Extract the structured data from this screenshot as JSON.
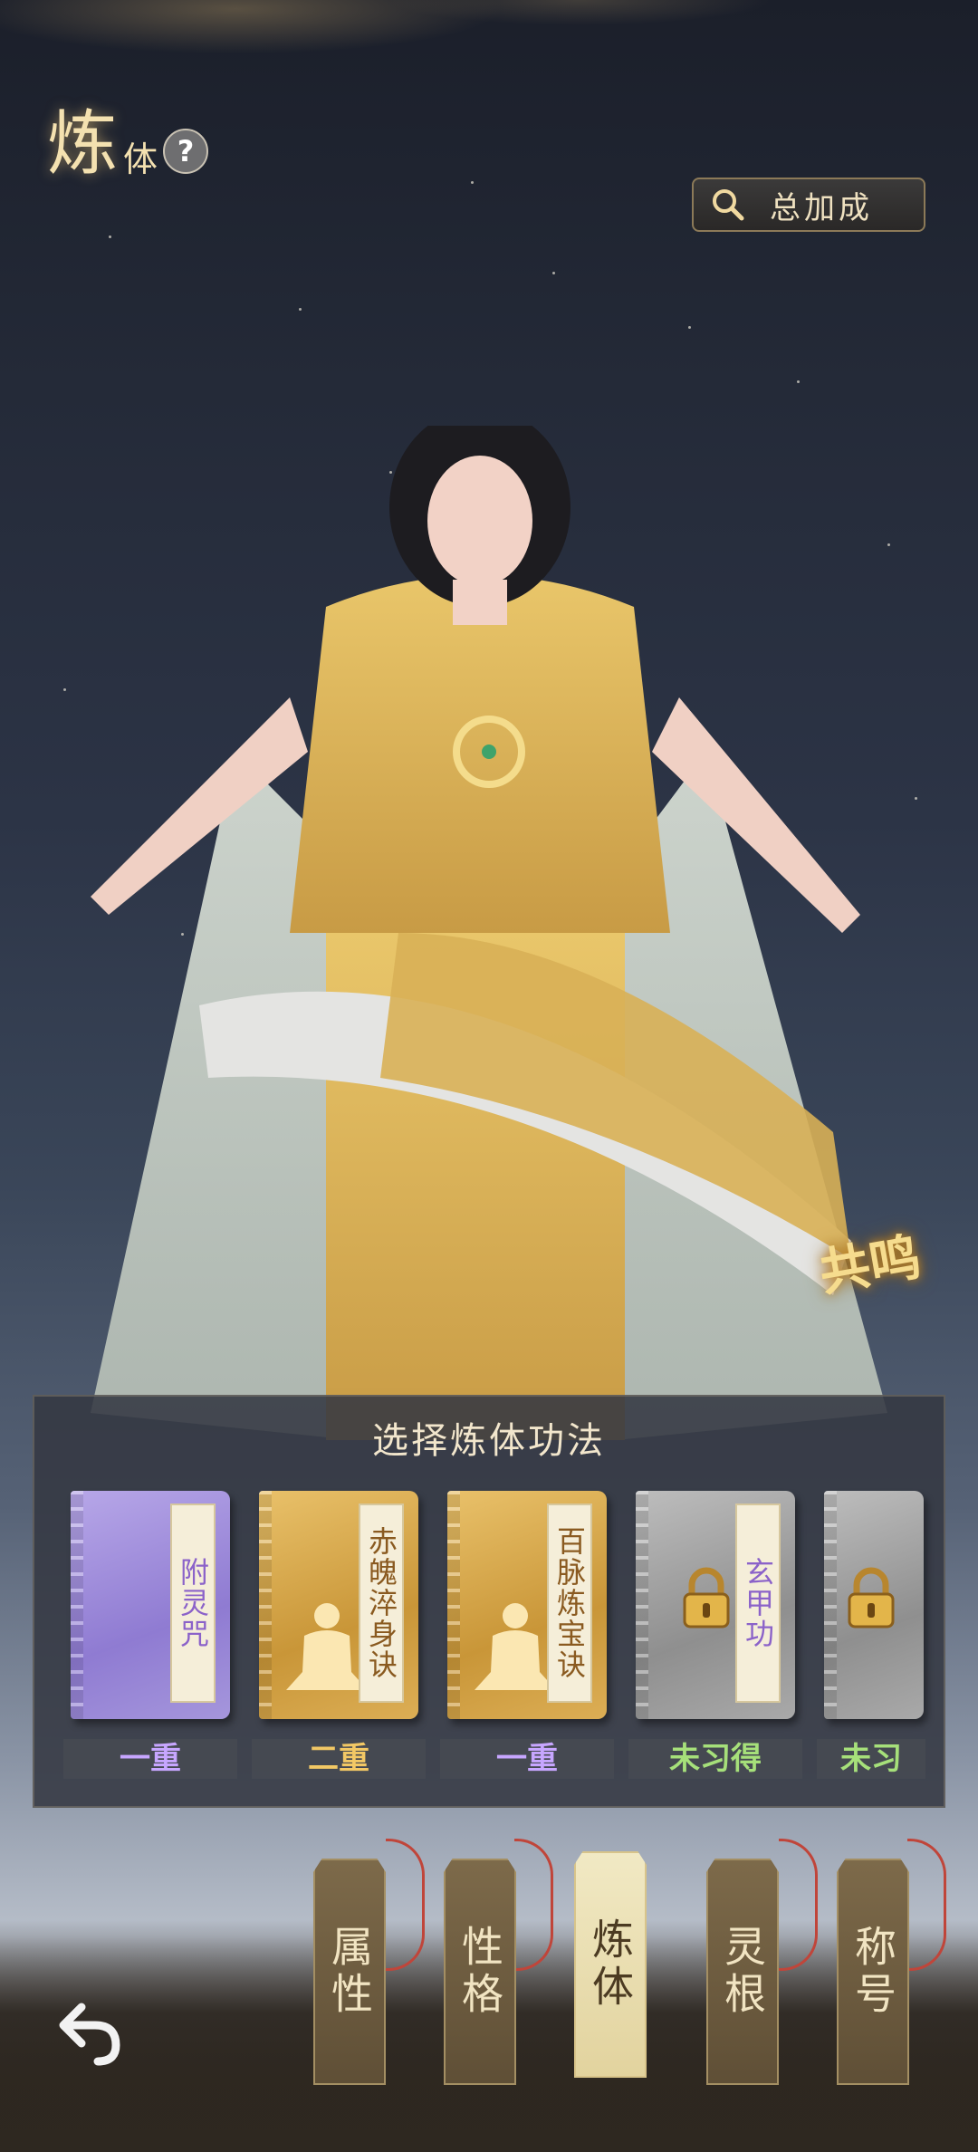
{
  "header": {
    "title_big": "炼",
    "title_small": "体",
    "help_glyph": "?",
    "bonus_button": "总加成"
  },
  "badge": {
    "resonance": "共鸣"
  },
  "panel": {
    "title": "选择炼体功法",
    "books": [
      {
        "name": "附灵咒",
        "rank": "一重",
        "style": "purple"
      },
      {
        "name": "赤魄淬身诀",
        "rank": "二重",
        "style": "gold"
      },
      {
        "name": "百脉炼宝诀",
        "rank": "一重",
        "style": "gold"
      },
      {
        "name": "玄甲功",
        "rank": "未习得",
        "style": "gray"
      },
      {
        "name": "",
        "rank": "未习",
        "style": "gray"
      }
    ]
  },
  "tabs": [
    {
      "label": "属性",
      "active": false
    },
    {
      "label": "性格",
      "active": false
    },
    {
      "label": "炼体",
      "active": true
    },
    {
      "label": "灵根",
      "active": false
    },
    {
      "label": "称号",
      "active": false
    }
  ],
  "colors": {
    "accent_gold": "#f4e1b0",
    "rank_purple": "#c7a6ff",
    "rank_gold": "#f2c865",
    "rank_green": "#a6e07a"
  }
}
